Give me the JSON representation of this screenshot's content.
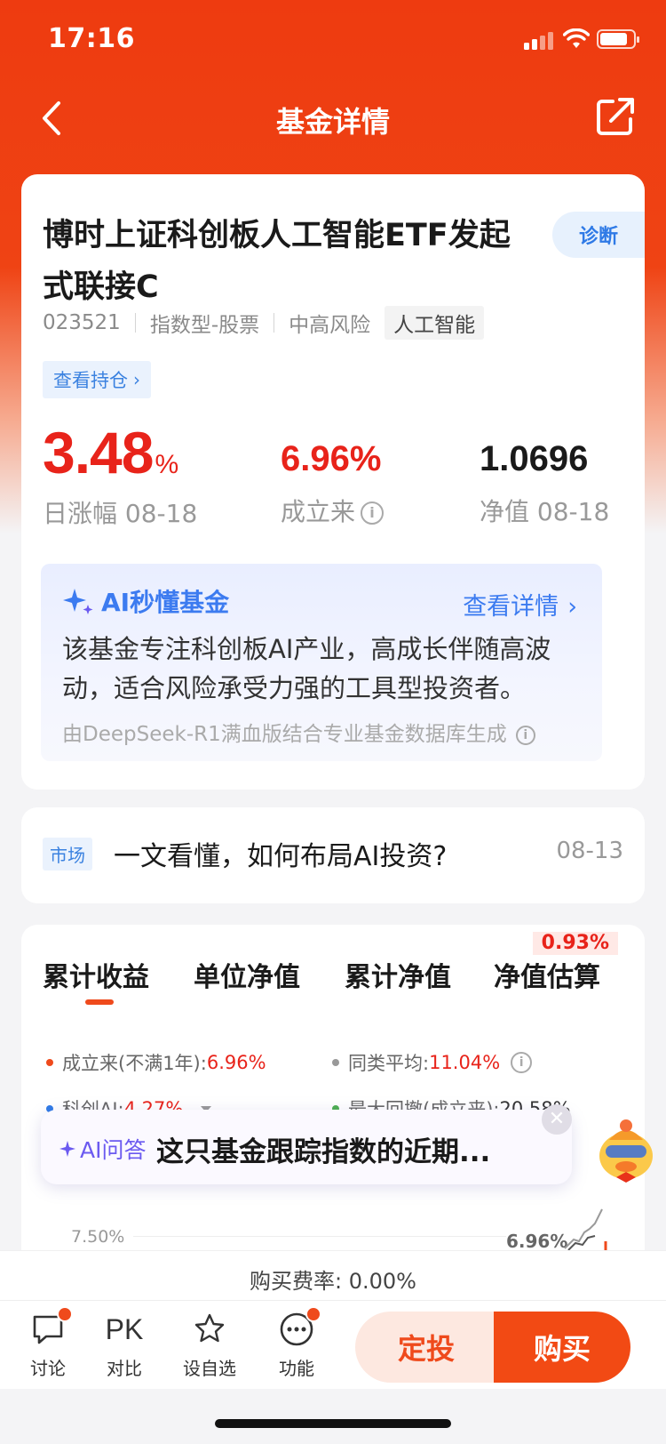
{
  "status": {
    "time": "17:16"
  },
  "nav": {
    "title": "基金详情"
  },
  "fund": {
    "name": "博时上证科创板人工智能ETF发起式联接C",
    "diagnose": "诊断",
    "code": "023521",
    "type": "指数型-股票",
    "risk": "中高风险",
    "theme": "人工智能",
    "holdings_link": "查看持仓"
  },
  "stats": {
    "daily_change_value": "3.48",
    "daily_change_unit": "%",
    "daily_change_label": "日涨幅 08-18",
    "since_inception_value": "6.96%",
    "since_inception_label": "成立来",
    "nav_value": "1.0696",
    "nav_label": "净值 08-18"
  },
  "ai_summary": {
    "title": "AI秒懂基金",
    "more": "查看详情",
    "text": "该基金专注科创板AI产业，高成长伴随高波动，适合风险承受力强的工具型投资者。",
    "source": "由DeepSeek-R1满血版结合专业基金数据库生成"
  },
  "news": {
    "tag": "市场",
    "title": "一文看懂，如何布局AI投资?",
    "date": "08-13"
  },
  "chart_tabs": {
    "tabs": [
      "累计收益",
      "单位净值",
      "累计净值",
      "净值估算"
    ],
    "active_index": 0,
    "estimate_badge": "0.93%"
  },
  "legend": {
    "since_label": "成立来(不满1年):",
    "since_value": "6.96%",
    "peer_label": "同类平均:",
    "peer_value": "11.04%",
    "index_label": "科创AI:",
    "index_value": "4.27%",
    "drawdown_label": "最大回撤(成立来):",
    "drawdown_value": "20.58%"
  },
  "ai_ask": {
    "label": "AI问答",
    "question": "这只基金跟踪指数的近期..."
  },
  "chart_partial": {
    "y_tick": "7.50%",
    "last_value_label": "6.96%"
  },
  "fee": {
    "text": "购买费率: 0.00%"
  },
  "bottom_bar": {
    "discuss": "讨论",
    "compare_icon": "PK",
    "compare": "对比",
    "watchlist": "设自选",
    "more": "功能",
    "sip": "定投",
    "buy": "购买"
  },
  "colors": {
    "brand": "#ee3b10",
    "rise": "#e8231a",
    "link": "#3b82e0"
  }
}
